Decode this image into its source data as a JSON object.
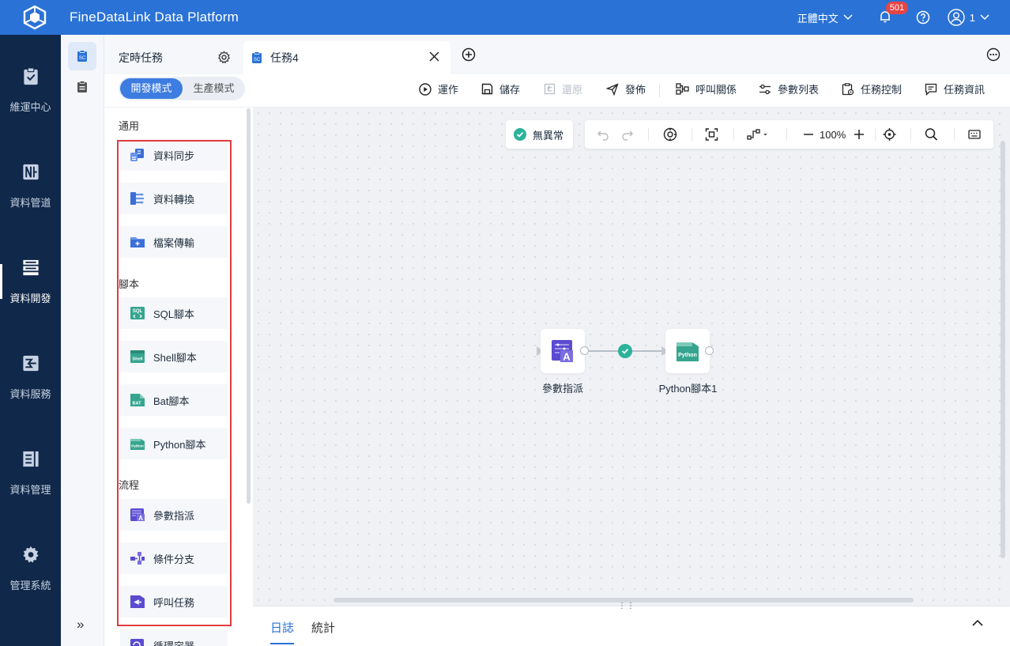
{
  "app": {
    "title": "FineDataLink Data Platform"
  },
  "topbar": {
    "language": "正體中文",
    "notification_count": "501",
    "user_name": "1"
  },
  "nav": {
    "items": [
      {
        "label": "維運中心",
        "icon": "clipboard-check-icon"
      },
      {
        "label": "資料管道",
        "icon": "pipeline-icon"
      },
      {
        "label": "資料開發",
        "icon": "dev-icon",
        "active": true
      },
      {
        "label": "資料服務",
        "icon": "service-icon"
      },
      {
        "label": "資料管理",
        "icon": "data-manage-icon"
      },
      {
        "label": "管理系統",
        "icon": "gear-icon"
      }
    ],
    "expand_label": "»"
  },
  "tabs": {
    "fixed_label": "定時任務",
    "active_label": "任務4"
  },
  "toolbar": {
    "mode_dev": "開發模式",
    "mode_prod": "生產模式",
    "run": "運作",
    "save": "儲存",
    "restore": "還原",
    "publish": "發佈",
    "call_relation": "呼叫關係",
    "param_list": "參數列表",
    "task_control": "任務控制",
    "task_info": "任務資訊"
  },
  "panel": {
    "section_general": "通用",
    "section_script": "腳本",
    "section_flow": "流程",
    "general": [
      "資料同步",
      "資料轉換",
      "檔案傳輸"
    ],
    "script": [
      "SQL腳本",
      "Shell腳本",
      "Bat腳本",
      "Python腳本"
    ],
    "flow": [
      "參數指派",
      "條件分支",
      "呼叫任務",
      "循環容器"
    ]
  },
  "canvas": {
    "status": "無異常",
    "zoom": "100%",
    "nodes": [
      {
        "label": "參數指派",
        "icon": "param-assign-icon"
      },
      {
        "label": "Python腳本1",
        "icon": "python-script-icon"
      }
    ]
  },
  "log": {
    "tab_log": "日誌",
    "tab_stats": "統計"
  },
  "colors": {
    "brand": "#2a72d6",
    "nav_bg": "#10284a",
    "success": "#2bb39a",
    "highlight": "#e03c3c"
  }
}
